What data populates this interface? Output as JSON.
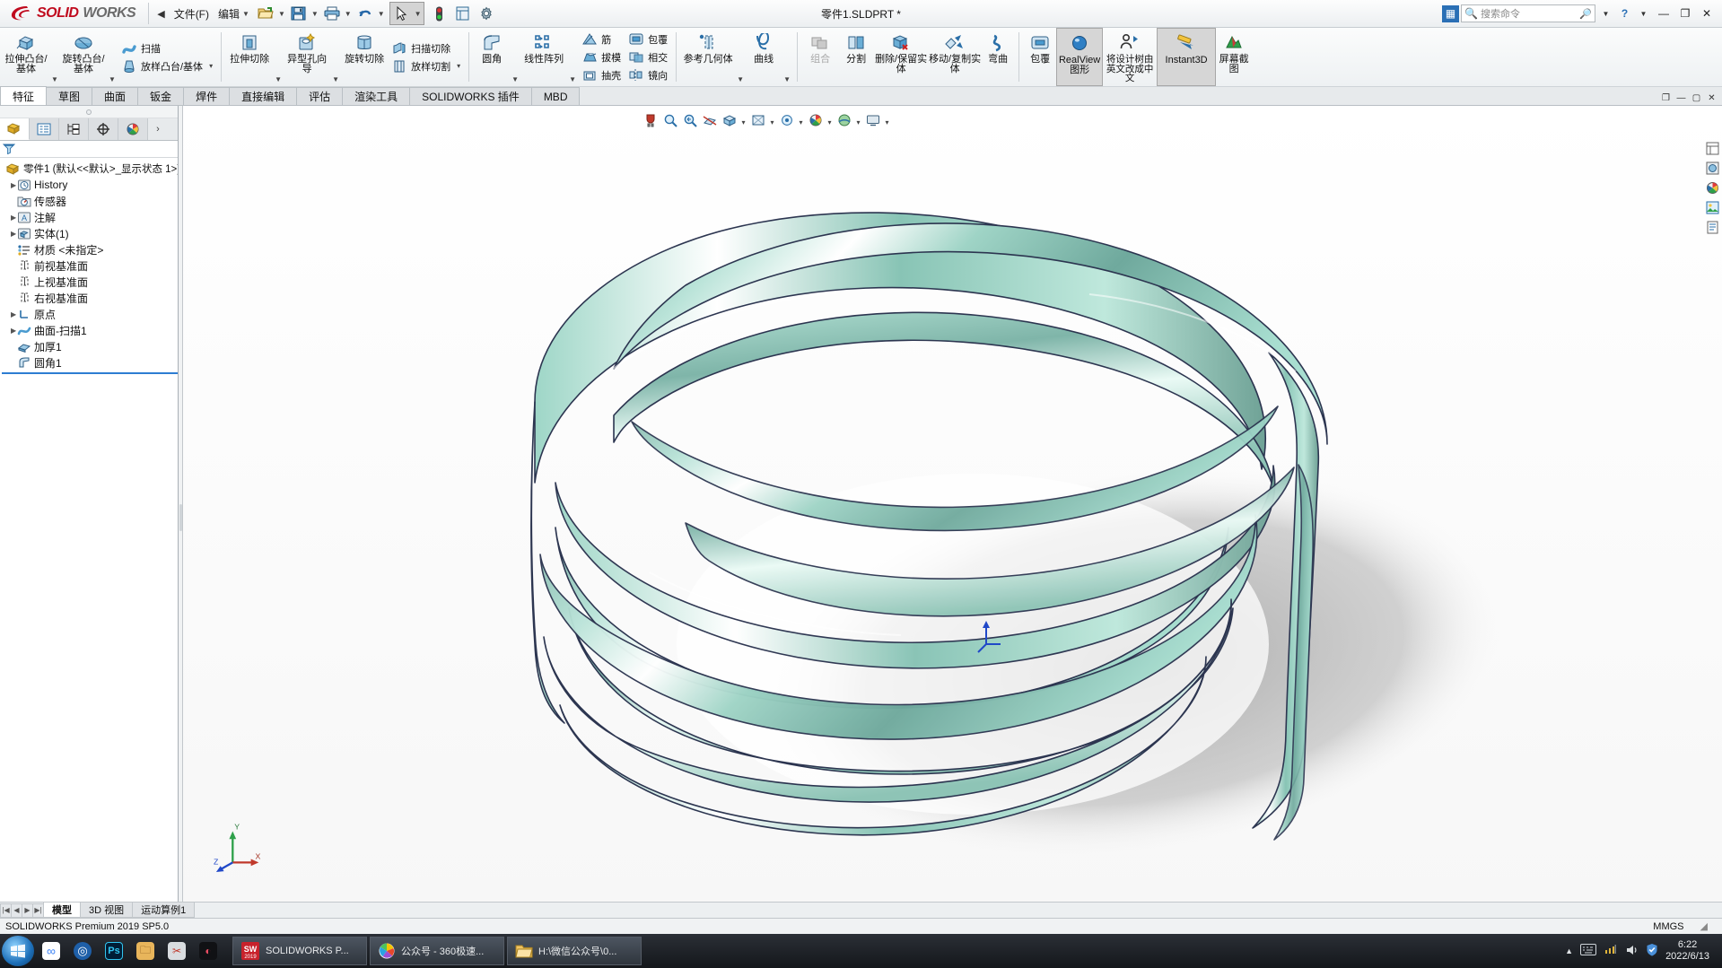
{
  "titlebar": {
    "brand_ds": "2S",
    "brand_solid": "SOLID",
    "brand_works": "WORKS",
    "collapse_arrow": "◀",
    "menus": [
      {
        "label": "文件(F)",
        "name": "menu-file",
        "caret": false
      },
      {
        "label": "编辑",
        "name": "menu-edit",
        "caret": true
      }
    ],
    "quick_buttons": [
      {
        "name": "open-button",
        "icon": "folder-open-icon",
        "caret": true
      },
      {
        "name": "save-button",
        "icon": "floppy-disk-icon",
        "caret": true
      },
      {
        "name": "print-button",
        "icon": "printer-icon",
        "caret": true
      },
      {
        "name": "undo-button",
        "icon": "undo-arrow-icon",
        "caret": true
      },
      {
        "name": "select-button",
        "icon": "cursor-arrow-icon",
        "caret": true
      },
      {
        "name": "rebuild-button",
        "icon": "traffic-light-icon",
        "caret": false
      },
      {
        "name": "display-button",
        "icon": "display-state-icon",
        "caret": false
      },
      {
        "name": "options-button",
        "icon": "gear-icon",
        "caret": false
      }
    ],
    "document_title": "零件1.SLDPRT *",
    "search_placeholder": "搜索命令",
    "right_icons": [
      "search-icon",
      "dropdown-caret-icon",
      "help-icon",
      "help-caret-icon"
    ],
    "window_buttons": [
      "minimize",
      "maximize",
      "close"
    ]
  },
  "ribbon": {
    "groups": [
      {
        "name": "group-boss-base",
        "big": [
          {
            "label": "拉伸凸台/基体",
            "name": "extruded-boss-base",
            "icon": "extrude-boss-icon",
            "caret": true
          },
          {
            "label": "旋转凸台/基体",
            "name": "revolved-boss-base",
            "icon": "revolve-boss-icon",
            "caret": true
          }
        ],
        "small": [
          {
            "label": "扫描",
            "name": "swept-boss-base",
            "icon": "sweep-icon"
          },
          {
            "label": "放样凸台/基体",
            "name": "lofted-boss-base",
            "icon": "loft-icon",
            "caret": true
          }
        ]
      },
      {
        "name": "group-cut",
        "big": [
          {
            "label": "拉伸切除",
            "name": "extruded-cut",
            "icon": "extrude-cut-icon",
            "caret": true
          },
          {
            "label": "异型孔向导",
            "name": "hole-wizard",
            "icon": "hole-wizard-icon",
            "caret": true
          },
          {
            "label": "旋转切除",
            "name": "revolved-cut",
            "icon": "revolve-cut-icon",
            "caret": false
          }
        ],
        "small": [
          {
            "label": "扫描切除",
            "name": "swept-cut",
            "icon": "sweep-cut-icon"
          },
          {
            "label": "放样切割",
            "name": "lofted-cut",
            "icon": "loft-cut-icon",
            "caret": true
          }
        ]
      },
      {
        "name": "group-features",
        "big": [
          {
            "label": "圆角",
            "name": "fillet",
            "icon": "fillet-icon",
            "caret": true
          },
          {
            "label": "线性阵列",
            "name": "linear-pattern",
            "icon": "linear-pattern-icon",
            "caret": true
          }
        ],
        "small": [
          {
            "label": "筋",
            "name": "rib",
            "icon": "rib-icon"
          },
          {
            "label": "拔模",
            "name": "draft",
            "icon": "draft-icon"
          },
          {
            "label": "抽壳",
            "name": "shell",
            "icon": "shell-icon"
          },
          {
            "label": "镜向",
            "name": "mirror",
            "icon": "mirror-icon"
          }
        ],
        "small2": [
          {
            "label": "包覆",
            "name": "wrap",
            "icon": "wrap-icon"
          },
          {
            "label": "相交",
            "name": "intersect",
            "icon": "intersect-icon"
          },
          {
            "label": "曲线",
            "name": "curves-small",
            "icon": "curve-icon"
          }
        ]
      },
      {
        "name": "group-reference",
        "big": [
          {
            "label": "参考几何体",
            "name": "reference-geometry",
            "icon": "reference-plane-icon",
            "caret": true
          },
          {
            "label": "曲线",
            "name": "curves",
            "icon": "curve-icon",
            "caret": true
          }
        ]
      },
      {
        "name": "group-bodies",
        "big": [
          {
            "label": "组合",
            "name": "combine",
            "icon": "combine-icon",
            "disabled": true
          },
          {
            "label": "分割",
            "name": "split",
            "icon": "split-icon",
            "disabled": false
          },
          {
            "label": "删除/保留实体",
            "name": "delete-keep-body",
            "icon": "delete-body-icon",
            "disabled": false
          },
          {
            "label": "移动/复制实体",
            "name": "move-copy-body",
            "icon": "move-copy-icon",
            "disabled": false
          },
          {
            "label": "弯曲",
            "name": "flex",
            "icon": "flex-icon",
            "disabled": false
          }
        ]
      },
      {
        "name": "group-display",
        "big": [
          {
            "label": "包覆",
            "name": "wrap-big",
            "icon": "wrap-icon"
          },
          {
            "label": "RealView 图形",
            "name": "realview-graphics",
            "icon": "realview-sphere-icon",
            "active": true
          },
          {
            "label": "将设计树由英文改成中文",
            "name": "translate-tree",
            "icon": "person-arrow-icon"
          },
          {
            "label": "Instant3D",
            "name": "instant3d",
            "icon": "instant3d-icon",
            "active": true
          },
          {
            "label": "屏幕截图",
            "name": "screen-capture",
            "icon": "capture-icon"
          }
        ]
      }
    ]
  },
  "command_tabs": [
    {
      "label": "特征",
      "name": "tab-features",
      "selected": true
    },
    {
      "label": "草图",
      "name": "tab-sketch",
      "selected": false
    },
    {
      "label": "曲面",
      "name": "tab-surfaces",
      "selected": false
    },
    {
      "label": "钣金",
      "name": "tab-sheetmetal",
      "selected": false
    },
    {
      "label": "焊件",
      "name": "tab-weldments",
      "selected": false
    },
    {
      "label": "直接编辑",
      "name": "tab-direct-edit",
      "selected": false
    },
    {
      "label": "评估",
      "name": "tab-evaluate",
      "selected": false
    },
    {
      "label": "渲染工具",
      "name": "tab-render-tools",
      "selected": false
    },
    {
      "label": "SOLIDWORKS 插件",
      "name": "tab-addins",
      "selected": false
    },
    {
      "label": "MBD",
      "name": "tab-mbd",
      "selected": false
    }
  ],
  "left_panel": {
    "tabs": [
      {
        "name": "feature-manager-tab",
        "icon": "feature-tree-icon",
        "selected": true
      },
      {
        "name": "property-manager-tab",
        "icon": "property-list-icon",
        "selected": false
      },
      {
        "name": "configuration-manager-tab",
        "icon": "configuration-icon",
        "selected": false
      },
      {
        "name": "dimxpert-manager-tab",
        "icon": "dimxpert-icon",
        "selected": false
      },
      {
        "name": "display-manager-tab",
        "icon": "display-palette-icon",
        "selected": false
      }
    ],
    "more_arrow": "›",
    "filter_icon": "filter-funnel-icon",
    "tree": [
      {
        "label": "零件1  (默认<<默认>_显示状态 1>)",
        "name": "tree-item-part",
        "icon": "part-icon",
        "expand": "",
        "indent": 0
      },
      {
        "label": "History",
        "name": "tree-item-history",
        "icon": "history-icon",
        "expand": "▶",
        "indent": 1
      },
      {
        "label": "传感器",
        "name": "tree-item-sensors",
        "icon": "sensor-icon",
        "expand": "",
        "indent": 1
      },
      {
        "label": "注解",
        "name": "tree-item-annotations",
        "icon": "annotation-icon",
        "expand": "▶",
        "indent": 1
      },
      {
        "label": "实体(1)",
        "name": "tree-item-solid-bodies",
        "icon": "solid-bodies-icon",
        "expand": "▶",
        "indent": 1
      },
      {
        "label": "材质 <未指定>",
        "name": "tree-item-material",
        "icon": "material-icon",
        "expand": "",
        "indent": 1
      },
      {
        "label": "前视基准面",
        "name": "tree-item-front-plane",
        "icon": "plane-icon",
        "expand": "",
        "indent": 1
      },
      {
        "label": "上视基准面",
        "name": "tree-item-top-plane",
        "icon": "plane-icon",
        "expand": "",
        "indent": 1
      },
      {
        "label": "右视基准面",
        "name": "tree-item-right-plane",
        "icon": "plane-icon",
        "expand": "",
        "indent": 1
      },
      {
        "label": "原点",
        "name": "tree-item-origin",
        "icon": "origin-icon",
        "expand": "",
        "indent": 1
      },
      {
        "label": "曲面-扫描1",
        "name": "tree-item-surface-sweep1",
        "icon": "surface-sweep-icon",
        "expand": "▶",
        "indent": 1
      },
      {
        "label": "加厚1",
        "name": "tree-item-thicken1",
        "icon": "thicken-icon",
        "expand": "",
        "indent": 1
      },
      {
        "label": "圆角1",
        "name": "tree-item-fillet1",
        "icon": "fillet-feature-icon",
        "expand": "",
        "indent": 1
      }
    ]
  },
  "view_toolbar": [
    {
      "name": "zoom-to-fit-button",
      "icon": "magnet-icon",
      "caret": false
    },
    {
      "name": "zoom-area-button",
      "icon": "zoom-area-icon",
      "caret": false
    },
    {
      "name": "previous-view-button",
      "icon": "previous-view-icon",
      "caret": false
    },
    {
      "name": "section-view-button",
      "icon": "section-view-icon",
      "caret": false
    },
    {
      "name": "view-orientation-button",
      "icon": "view-orientation-icon",
      "caret": false
    },
    {
      "name": "display-style-button",
      "icon": "display-style-icon",
      "caret": true
    },
    {
      "name": "hide-show-button",
      "icon": "hide-show-icon",
      "caret": true
    },
    {
      "name": "edit-appearance-button",
      "icon": "appearance-icon",
      "caret": true
    },
    {
      "name": "apply-scene-button",
      "icon": "scene-icon",
      "caret": true
    },
    {
      "name": "view-settings-button",
      "icon": "viewport-icon",
      "caret": true
    }
  ],
  "right_strip": [
    {
      "name": "view-palette-icon"
    },
    {
      "name": "appearances-icon"
    },
    {
      "name": "decals-icon"
    },
    {
      "name": "scenes-icon"
    },
    {
      "name": "custom-properties-icon"
    }
  ],
  "graphics_window_buttons": [
    "restore-icon",
    "minimize-icon",
    "maximize-icon",
    "close-icon"
  ],
  "triad": {
    "x_label": "X",
    "y_label": "Y",
    "z_label": "Z"
  },
  "doc_tabs": {
    "nav": [
      "|◀",
      "◀",
      "▶",
      "▶|"
    ],
    "tabs": [
      {
        "label": "模型",
        "name": "doc-tab-model",
        "selected": true
      },
      {
        "label": "3D 视图",
        "name": "doc-tab-3dviews",
        "selected": false
      },
      {
        "label": "运动算例1",
        "name": "doc-tab-motion-study",
        "selected": false
      }
    ]
  },
  "statusbar": {
    "left": "SOLIDWORKS Premium 2019 SP5.0",
    "units": "MMGS",
    "edit_indicator": ""
  },
  "taskbar": {
    "start_icon": "windows-start-icon",
    "quick_icons": [
      {
        "name": "baidu-netdisk-icon",
        "glyph": "∞",
        "bg": "#ffffff",
        "fg": "#3b82f6"
      },
      {
        "name": "browser-icon",
        "glyph": "◎",
        "bg": "#1e5fa8",
        "fg": "#ffffff"
      },
      {
        "name": "photoshop-icon",
        "glyph": "Ps",
        "bg": "#001e36",
        "fg": "#31c5f0"
      },
      {
        "name": "folder-icon",
        "glyph": "🗀",
        "bg": "#e8b55b",
        "fg": "#7a4a12"
      },
      {
        "name": "snipping-tool-icon",
        "glyph": "✂",
        "bg": "#cfd3d6",
        "fg": "#c0392b"
      },
      {
        "name": "obs-icon",
        "glyph": "◐",
        "bg": "#101114",
        "fg": "#e84c62"
      }
    ],
    "items": [
      {
        "label": "SOLIDWORKS P...",
        "name": "taskbar-solidworks",
        "icon": "solidworks-icon"
      },
      {
        "label": "公众号 - 360极速...",
        "name": "taskbar-browser",
        "icon": "360-browser-icon"
      },
      {
        "label": "H:\\微信公众号\\0...",
        "name": "taskbar-explorer",
        "icon": "folder-window-icon"
      }
    ],
    "tray_icons": [
      "keyboard-icon",
      "network-icon",
      "volume-icon",
      "shield-icon"
    ],
    "clock_time": "6:22",
    "clock_date": "2022/6/13"
  }
}
